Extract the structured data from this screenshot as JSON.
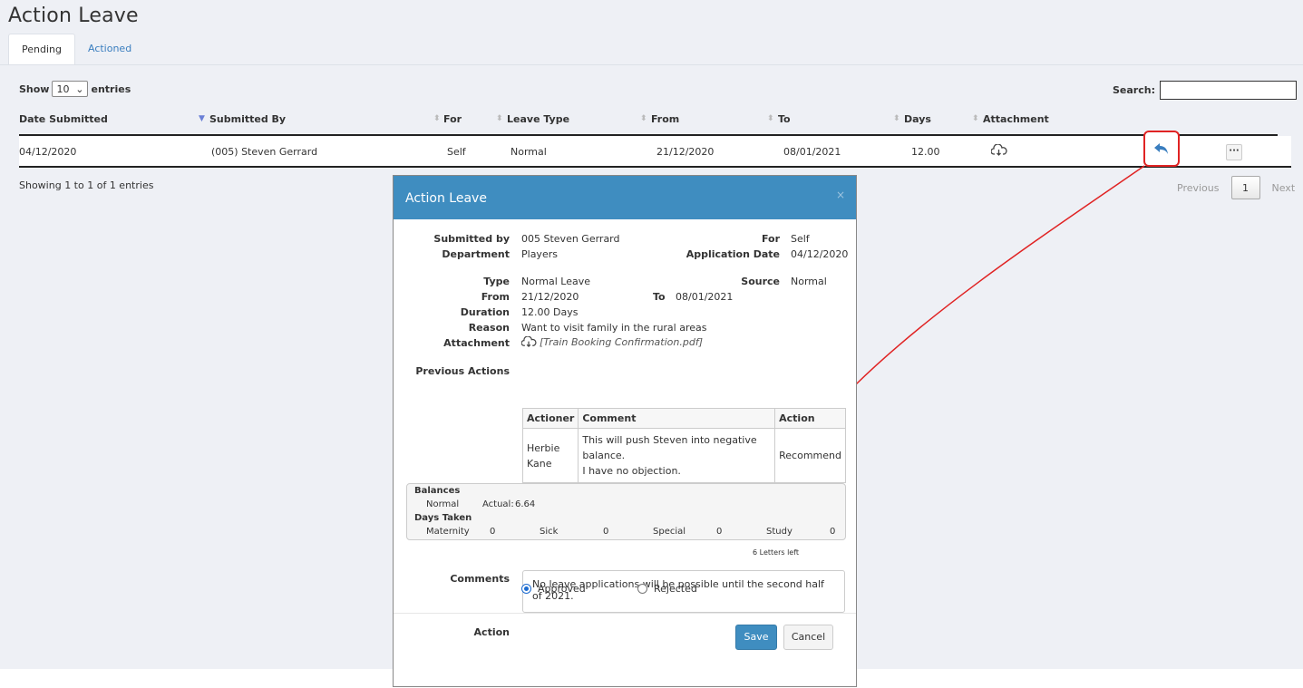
{
  "page": {
    "title": "Action Leave"
  },
  "tabs": [
    {
      "label": "Pending",
      "active": true
    },
    {
      "label": "Actioned",
      "active": false
    }
  ],
  "table_controls": {
    "show_label": "Show",
    "entries_value": "10",
    "entries_label": "entries",
    "search_label": "Search:",
    "search_value": ""
  },
  "table": {
    "columns": [
      "Date Submitted",
      "Submitted By",
      "For",
      "Leave Type",
      "From",
      "To",
      "Days",
      "Attachment"
    ],
    "rows": [
      {
        "date_submitted": "04/12/2020",
        "submitted_by": "(005)  Steven  Gerrard",
        "for": "Self",
        "leave_type": "Normal",
        "from": "21/12/2020",
        "to": "08/01/2021",
        "days": "12.00",
        "attachment_icon": "cloud-download-icon"
      }
    ],
    "more_label": "···",
    "info": "Showing 1 to 1 of 1 entries",
    "pager": {
      "previous": "Previous",
      "current": "1",
      "next": "Next"
    }
  },
  "modal": {
    "title": "Action Leave",
    "close": "×",
    "submitted_by_label": "Submitted by",
    "submitted_by": "005 Steven Gerrard",
    "department_label": "Department",
    "department": "Players",
    "for_label": "For",
    "for": "Self",
    "application_date_label": "Application Date",
    "application_date": "04/12/2020",
    "type_label": "Type",
    "type": "Normal Leave",
    "source_label": "Source",
    "source": "Normal",
    "from_label": "From",
    "from": "21/12/2020",
    "to_label": "To",
    "to": "08/01/2021",
    "duration_label": "Duration",
    "duration": "12.00 Days",
    "reason_label": "Reason",
    "reason": "Want to visit family in the rural areas",
    "attachment_label": "Attachment",
    "attachment": "[Train Booking Confirmation.pdf]",
    "previous_actions_label": "Previous Actions",
    "previous_actions": {
      "headers": [
        "Actioner",
        "Comment",
        "Action"
      ],
      "rows": [
        {
          "actioner_line1": "Herbie",
          "actioner_line2": "Kane",
          "comment_line1": "This will push Steven into negative balance.",
          "comment_line2": "I have no objection.",
          "action": "Recommend"
        }
      ]
    },
    "balances": {
      "heading": "Balances",
      "normal_label": "Normal",
      "actual_label": "Actual:",
      "actual_value": "6.64",
      "days_taken_heading": "Days Taken",
      "maternity_label": "Maternity",
      "maternity": "0",
      "sick_label": "Sick",
      "sick": "0",
      "special_label": "Special",
      "special": "0",
      "study_label": "Study",
      "study": "0"
    },
    "letters_left": "6 Letters left",
    "comments_label": "Comments",
    "comments_value": "No leave applications will be possible until the second half of 2021.",
    "action_label": "Action",
    "options": [
      {
        "label": "Approved",
        "selected": true
      },
      {
        "label": "Rejected",
        "selected": false
      }
    ],
    "save_label": "Save",
    "cancel_label": "Cancel"
  },
  "colors": {
    "header_blue": "#3f8dc0",
    "annotation_red": "#e02323",
    "link_blue": "#3a7ebf"
  }
}
